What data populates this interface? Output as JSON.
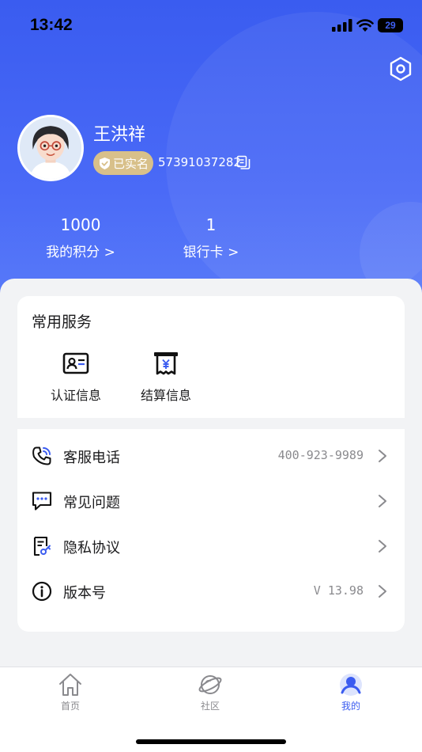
{
  "status_bar": {
    "time": "13:42",
    "battery": "29"
  },
  "profile": {
    "name": "王洪祥",
    "verified_label": "已实名",
    "user_id": "57391037282"
  },
  "stats": [
    {
      "value": "1000",
      "label": "我的积分 >"
    },
    {
      "value": "1",
      "label": "银行卡 >"
    }
  ],
  "services": {
    "title": "常用服务",
    "items": [
      {
        "label": "认证信息",
        "icon": "id-card-icon"
      },
      {
        "label": "结算信息",
        "icon": "receipt-icon"
      }
    ]
  },
  "menu": [
    {
      "label": "客服电话",
      "value": "400-923-9989",
      "icon": "phone-icon"
    },
    {
      "label": "常见问题",
      "value": "",
      "icon": "chat-icon"
    },
    {
      "label": "隐私协议",
      "value": "",
      "icon": "document-key-icon"
    },
    {
      "label": "版本号",
      "value": "V 13.98",
      "icon": "info-icon"
    }
  ],
  "tabbar": [
    {
      "label": "首页",
      "icon": "home-icon",
      "active": false
    },
    {
      "label": "社区",
      "icon": "planet-icon",
      "active": false
    },
    {
      "label": "我的",
      "icon": "profile-icon",
      "active": true
    }
  ],
  "colors": {
    "accent": "#3b5cf0",
    "badge": "#d8c08a",
    "muted": "#8a8a8e"
  }
}
